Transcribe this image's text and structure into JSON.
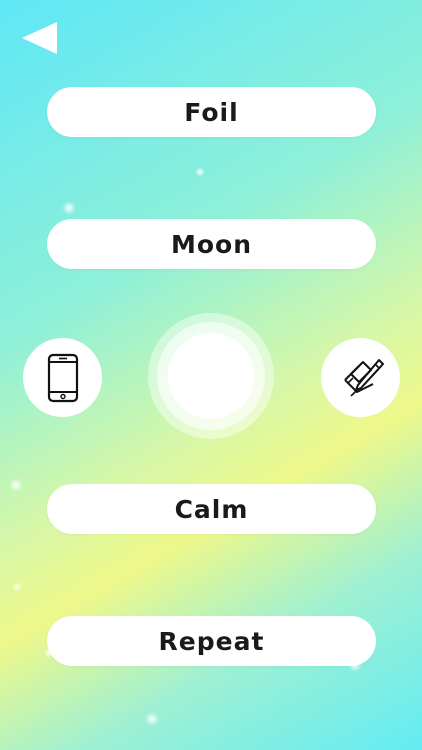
{
  "nav": {
    "back_icon": "back-triangle-icon"
  },
  "menu": {
    "items": [
      {
        "label": "Foil"
      },
      {
        "label": "Moon"
      },
      {
        "label": "Calm"
      },
      {
        "label": "Repeat"
      }
    ]
  },
  "controls": {
    "left_icon": "smartphone-icon",
    "right_icon": "pen-notepad-icon",
    "center": "breathing-circle"
  },
  "colors": {
    "background_start": "#5fe7f6",
    "background_mid": "#eef88a",
    "button_bg": "#ffffff",
    "text": "#1a1a1a"
  }
}
